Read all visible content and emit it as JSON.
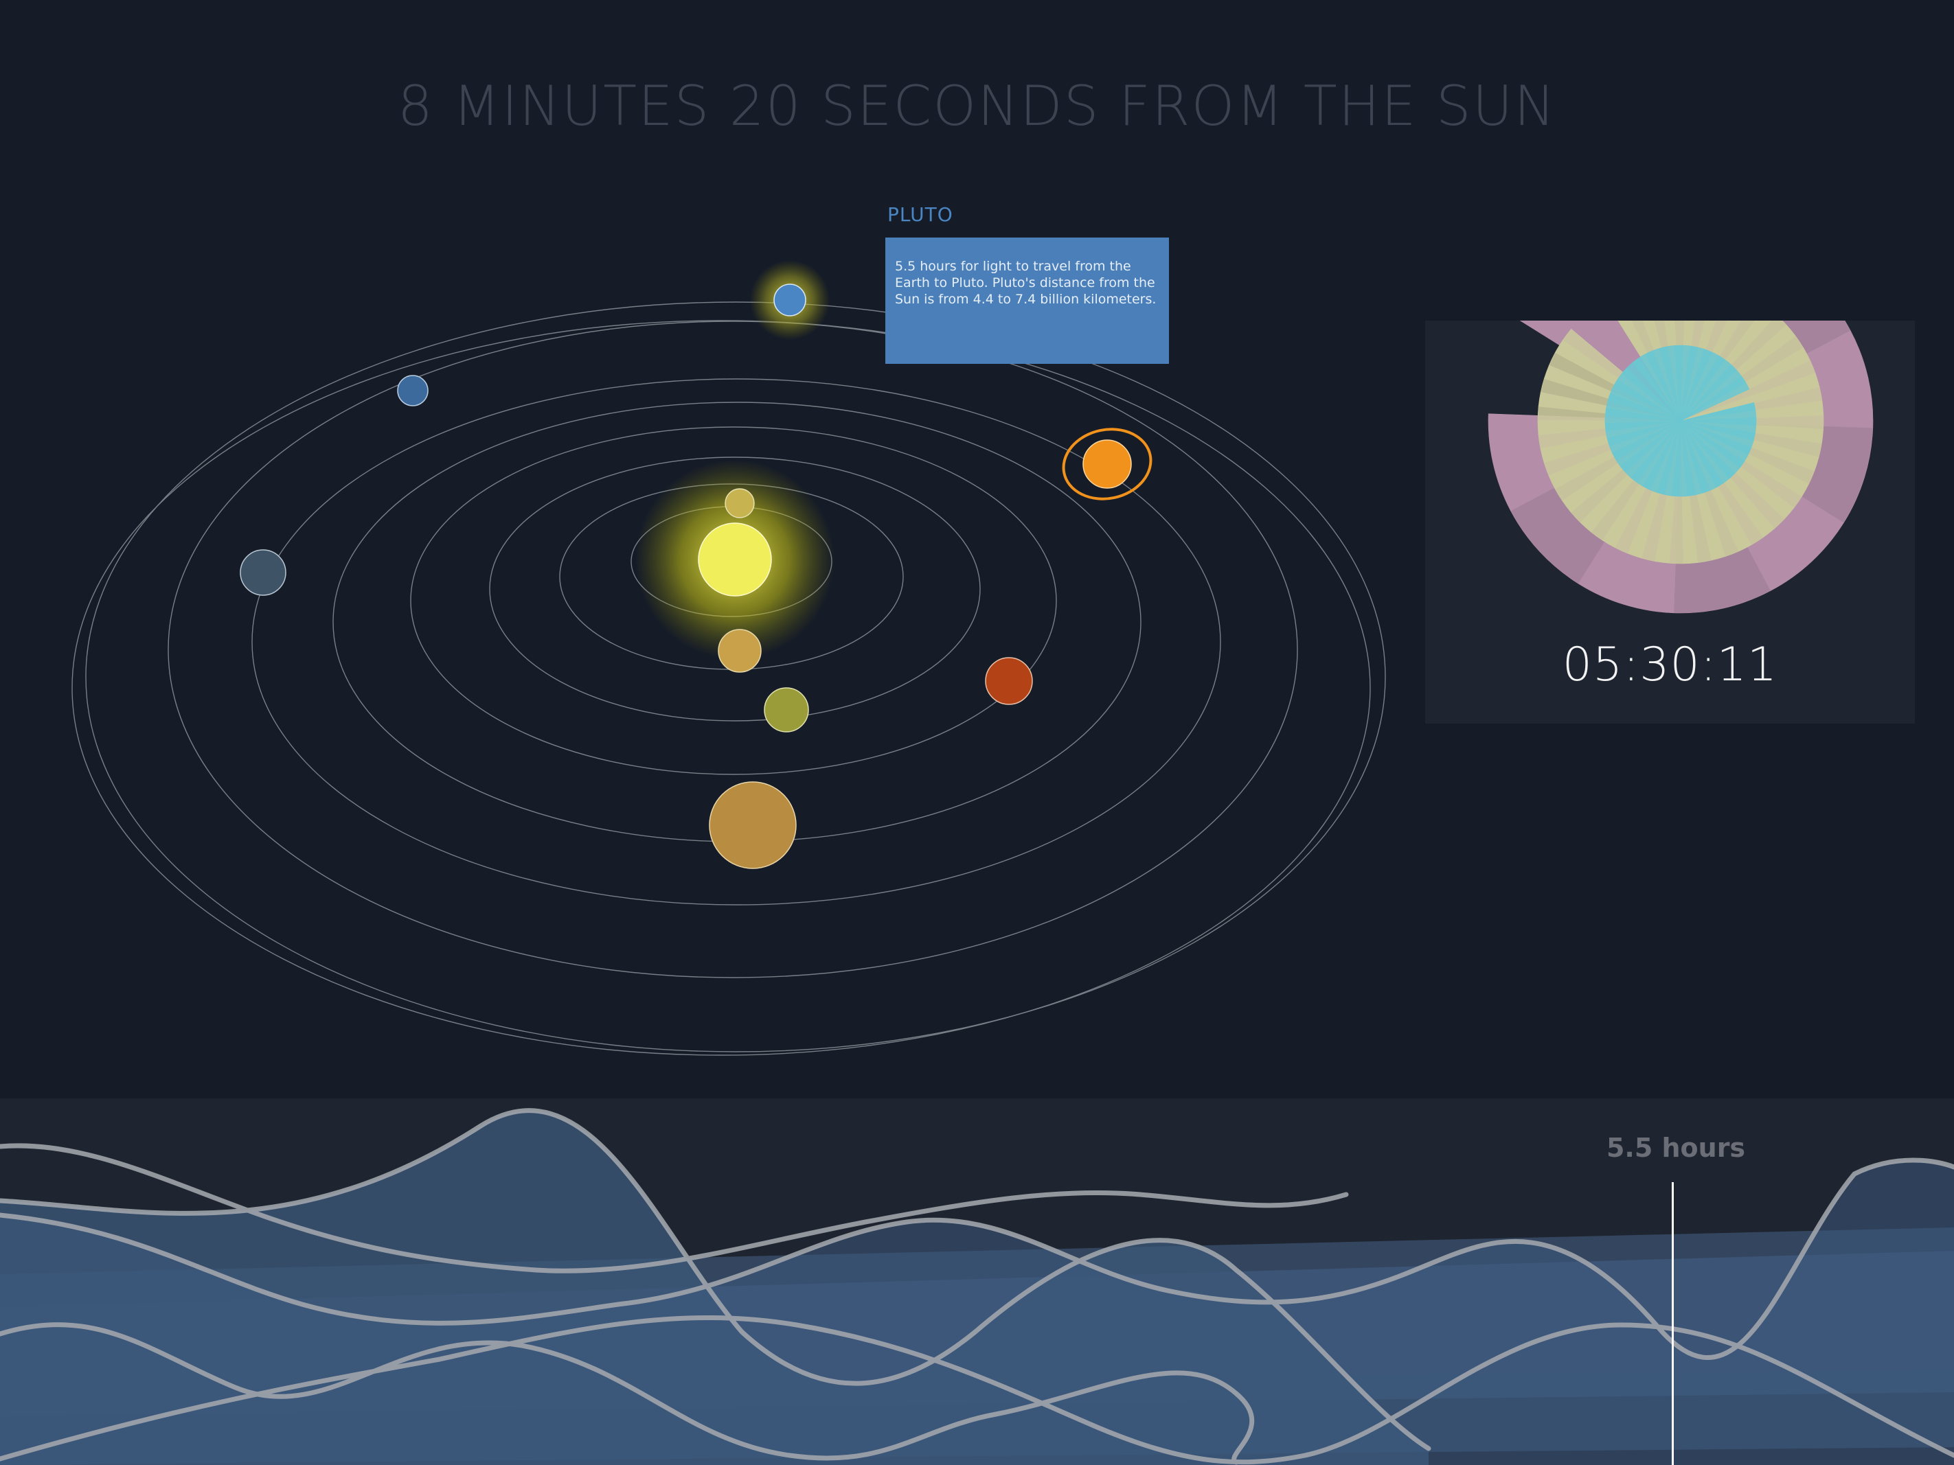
{
  "title": "8 MINUTES 20 SECONDS FROM THE SUN",
  "tooltip": {
    "title": "PLUTO",
    "body": "5.5 hours for light to travel from the Earth to Pluto. Pluto's distance from the Sun is from 4.4 to 7.4 billion kilometers."
  },
  "clock": {
    "time": "05:30:11",
    "colors": {
      "outer": "#b48ea8",
      "middle": "#cac99c",
      "inner": "#6cc7d1",
      "panel": "#1f2530"
    },
    "rings": [
      {
        "name": "hours",
        "fraction": 0.917
      },
      {
        "name": "minutes",
        "fraction": 0.95
      },
      {
        "name": "seconds",
        "fraction": 0.97
      }
    ]
  },
  "timeline": {
    "marker_label": "5.5 hours"
  },
  "colors": {
    "background": "#161c27",
    "sun": "#f1ee5c",
    "orbit": "#9aa0a8",
    "highlight": "#f0921c",
    "tooltip": "#4a7fba"
  }
}
